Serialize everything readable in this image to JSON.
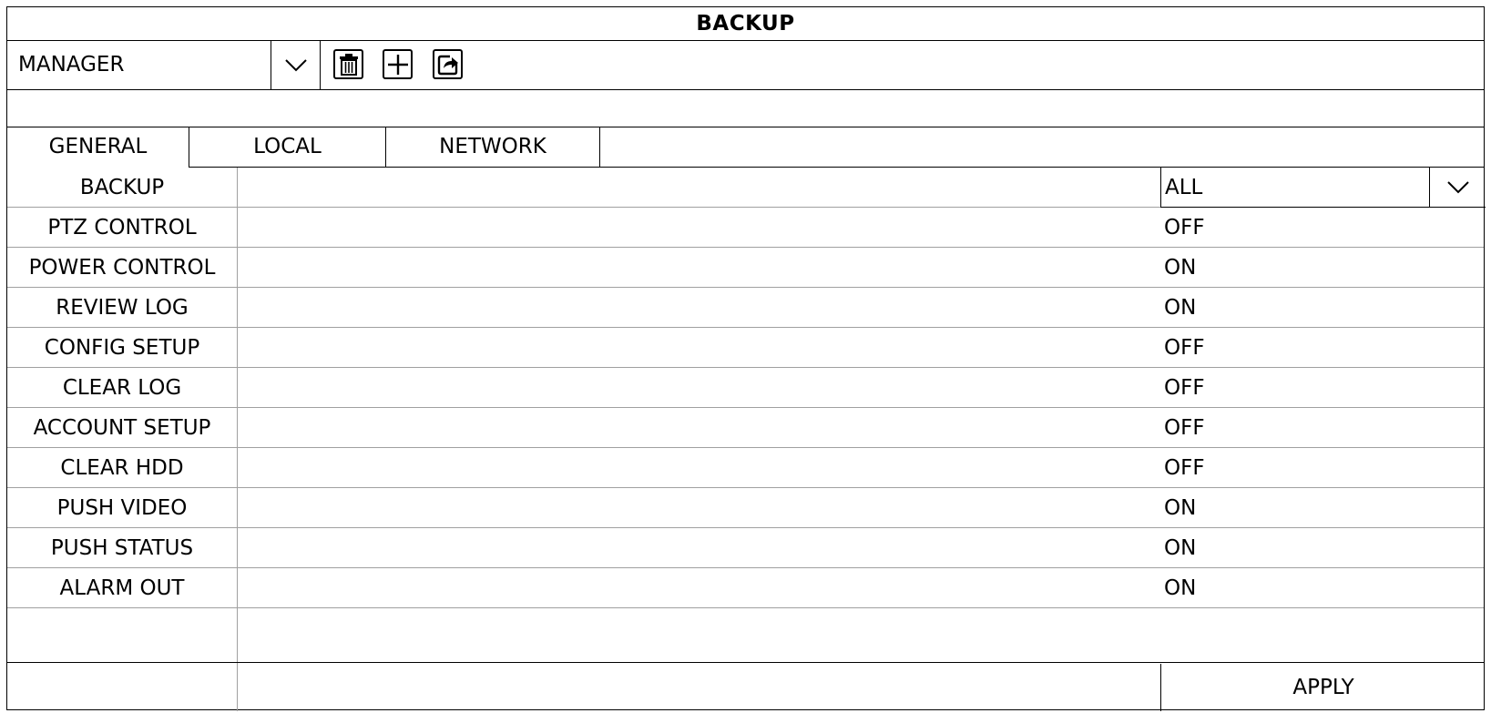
{
  "window": {
    "title": "BACKUP"
  },
  "toolbar": {
    "user": "MANAGER",
    "icons": [
      "chevron-down-icon",
      "trash-icon",
      "plus-icon",
      "export-icon"
    ]
  },
  "tabs": [
    {
      "label": "GENERAL",
      "active": true
    },
    {
      "label": "LOCAL",
      "active": false
    },
    {
      "label": "NETWORK",
      "active": false
    }
  ],
  "settings": [
    {
      "label": "BACKUP",
      "value": "ALL",
      "type": "select"
    },
    {
      "label": "PTZ CONTROL",
      "value": "OFF"
    },
    {
      "label": "POWER CONTROL",
      "value": "ON"
    },
    {
      "label": "REVIEW LOG",
      "value": "ON"
    },
    {
      "label": "CONFIG SETUP",
      "value": "OFF"
    },
    {
      "label": "CLEAR LOG",
      "value": "OFF"
    },
    {
      "label": "ACCOUNT SETUP",
      "value": "OFF"
    },
    {
      "label": "CLEAR HDD",
      "value": "OFF"
    },
    {
      "label": "PUSH VIDEO",
      "value": "ON"
    },
    {
      "label": "PUSH STATUS",
      "value": "ON"
    },
    {
      "label": "ALARM OUT",
      "value": "ON"
    }
  ],
  "footer": {
    "apply_label": "APPLY"
  }
}
